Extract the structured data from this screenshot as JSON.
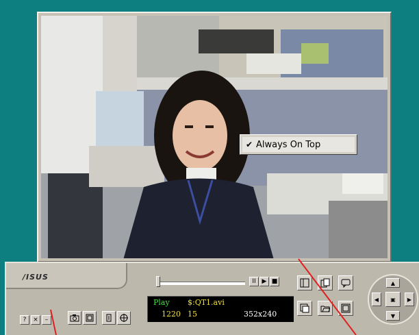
{
  "context_menu": {
    "item_label": "Always On Top",
    "checked": true,
    "check_glyph": "✔"
  },
  "brand": {
    "logo_text": "/ISUS"
  },
  "window_buttons": {
    "help": "?",
    "close": "×",
    "minimize": "–"
  },
  "transport": {
    "pause": "II",
    "play": "▶",
    "stop": "■"
  },
  "lcd": {
    "mode": "Play",
    "file": "$:QT1.avi",
    "frame": "1220",
    "rate": "15",
    "resolution": "352x240"
  },
  "icons": {
    "snapshot": "camera-icon",
    "fullscreen": "fullscreen-icon",
    "record": "record-icon",
    "settings": "target-icon",
    "frame_mode": "frame-mode-icon",
    "copy": "copy-icon",
    "chat": "chat-icon",
    "capture": "capture-icon",
    "open_folder": "folder-open-icon",
    "image": "image-icon"
  },
  "nav_pad": {
    "up": "▲",
    "down": "▼",
    "left": "◀",
    "right": "▶",
    "center": "▣"
  },
  "colors": {
    "desktop": "#0e7f80",
    "panel": "#bcb8ac",
    "lcd_green": "#3ee33e",
    "lcd_yellow": "#f0e040"
  }
}
